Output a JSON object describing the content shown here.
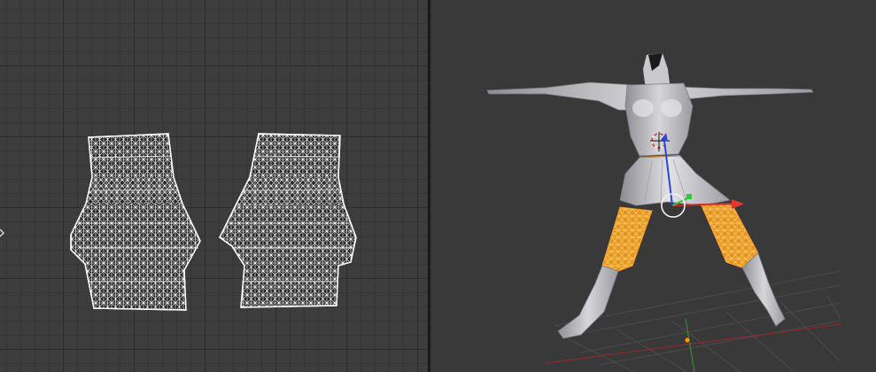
{
  "app": {
    "uv_editor": {
      "title": ""
    },
    "viewport": {
      "title": ""
    }
  },
  "colors": {
    "uv_background": "#3d3d3d",
    "viewport_background": "#393939",
    "wire_white": "#ffffff",
    "selection_orange": "#f39a1b",
    "mesh_gray": "#b8b8bc",
    "axis_x": "#cc2c2c",
    "axis_y": "#39c23b",
    "axis_z": "#2e43d8",
    "origin": "#ff9a00"
  },
  "icons": {
    "uv_cursor": "uv-cursor-icon",
    "cursor_3d": "3d-cursor-icon",
    "manipulator": "transform-manipulator-icon",
    "origin": "object-origin-icon"
  }
}
